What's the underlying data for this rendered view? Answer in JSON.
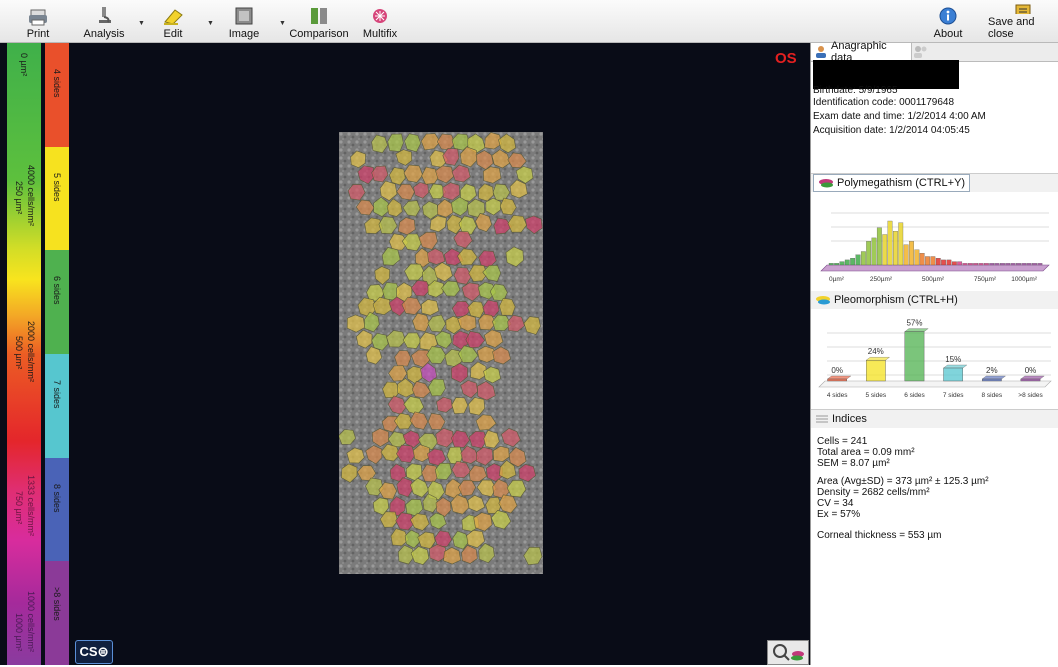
{
  "toolbar": {
    "print": "Print",
    "analysis": "Analysis",
    "edit": "Edit",
    "image": "Image",
    "comparison": "Comparison",
    "multifix": "Multifix",
    "about": "About",
    "save_close": "Save and close"
  },
  "eye_label": "OS",
  "logo_text": "CS⊜",
  "scale_left": {
    "labels": [
      "0 µm²",
      "4000 cells/mm²",
      "250 µm²",
      "2000 cells/mm²",
      "500 µm²",
      "1333 cells/mm²",
      "750 µm²",
      "1000 cells/mm²",
      "1000 µm²"
    ]
  },
  "scale_right": {
    "segments": [
      {
        "label": "4 sides",
        "color": "#e9502b"
      },
      {
        "label": "5 sides",
        "color": "#f6e21f"
      },
      {
        "label": "6 sides",
        "color": "#4fb14f"
      },
      {
        "label": "7 sides",
        "color": "#56c6cf"
      },
      {
        "label": "8 sides",
        "color": "#4a63b7"
      },
      {
        "label": ">8 sides",
        "color": "#8b3a98"
      }
    ]
  },
  "panel": {
    "tab_anagraphic": "Anagraphic data",
    "birthdate": "Birthdate: 5/9/1965",
    "identification": "Identification code: 0001179648",
    "exam_date": "Exam date and time: 1/2/2014 4:00 AM",
    "acquisition": "Acquisition date: 1/2/2014 04:05:45",
    "polymegathism_title": "Polymegathism (CTRL+Y)",
    "polymegathism_axis": [
      "0µm²",
      "250µm²",
      "500µm²",
      "750µm²",
      "1000µm²"
    ],
    "pleomorphism_title": "Pleomorphism (CTRL+H)",
    "indices_title": "Indices",
    "indices": {
      "cells": "Cells = 241",
      "total_area": "Total area = 0.09 mm²",
      "sem": "SEM = 8.07 µm²",
      "area": "Area (Avg±SD) = 373 µm² ± 125.3 µm²",
      "density": "Density = 2682 cells/mm²",
      "cv": "CV = 34",
      "ex": "Ex = 57%",
      "corneal": "Corneal thickness = 553 µm"
    }
  },
  "chart_data": [
    {
      "type": "bar",
      "title": "Polymegathism (CTRL+Y)",
      "categories": [
        "0µm²",
        "250µm²",
        "500µm²",
        "750µm²",
        "1000µm²"
      ],
      "x_range": [
        0,
        1000
      ],
      "values": [
        1,
        1,
        2,
        3,
        4,
        6,
        8,
        14,
        16,
        22,
        18,
        26,
        20,
        25,
        12,
        14,
        9,
        7,
        5,
        5,
        4,
        3,
        3,
        2,
        2,
        1,
        1,
        1,
        1,
        1,
        1,
        1,
        1,
        1,
        1,
        1,
        1,
        1,
        1,
        1
      ]
    },
    {
      "type": "bar",
      "title": "Pleomorphism (CTRL+H)",
      "categories": [
        "4 sides",
        "5 sides",
        "6 sides",
        "7 sides",
        "8 sides",
        ">8 sides"
      ],
      "values": [
        0,
        24,
        57,
        15,
        2,
        0
      ],
      "data_labels": [
        "0%",
        "24%",
        "57%",
        "15%",
        "2%",
        "0%"
      ],
      "colors": [
        "#e9502b",
        "#f4e11f",
        "#4fb14f",
        "#56c6cf",
        "#4a63b7",
        "#8b3a98"
      ]
    }
  ]
}
